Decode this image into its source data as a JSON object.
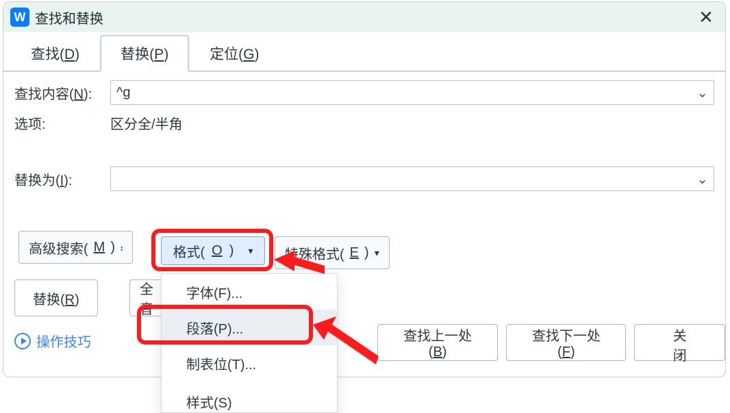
{
  "title": "查找和替换",
  "tabs": {
    "find": "查找(D)",
    "replace": "替换(P)",
    "goto": "定位(G)"
  },
  "labels": {
    "findWhat": "查找内容(N):",
    "options": "选项:",
    "replaceWith": "替换为(I):"
  },
  "values": {
    "findInput": "^g",
    "optionsText": "区分全/半角",
    "replaceInput": ""
  },
  "toolbar": {
    "advanced": "高级搜索(M)",
    "format": "格式(O)",
    "special": "特殊格式(E)"
  },
  "buttons": {
    "replace": "替换(R)",
    "replaceAll": "全部替换",
    "findPrev": "查找上一处(B)",
    "findNext": "查找下一处(F)",
    "close": "关闭"
  },
  "menu": {
    "font": "字体(F)...",
    "paragraph": "段落(P)...",
    "tab": "制表位(T)...",
    "style": "样式(S)"
  },
  "tips": "操作技巧"
}
